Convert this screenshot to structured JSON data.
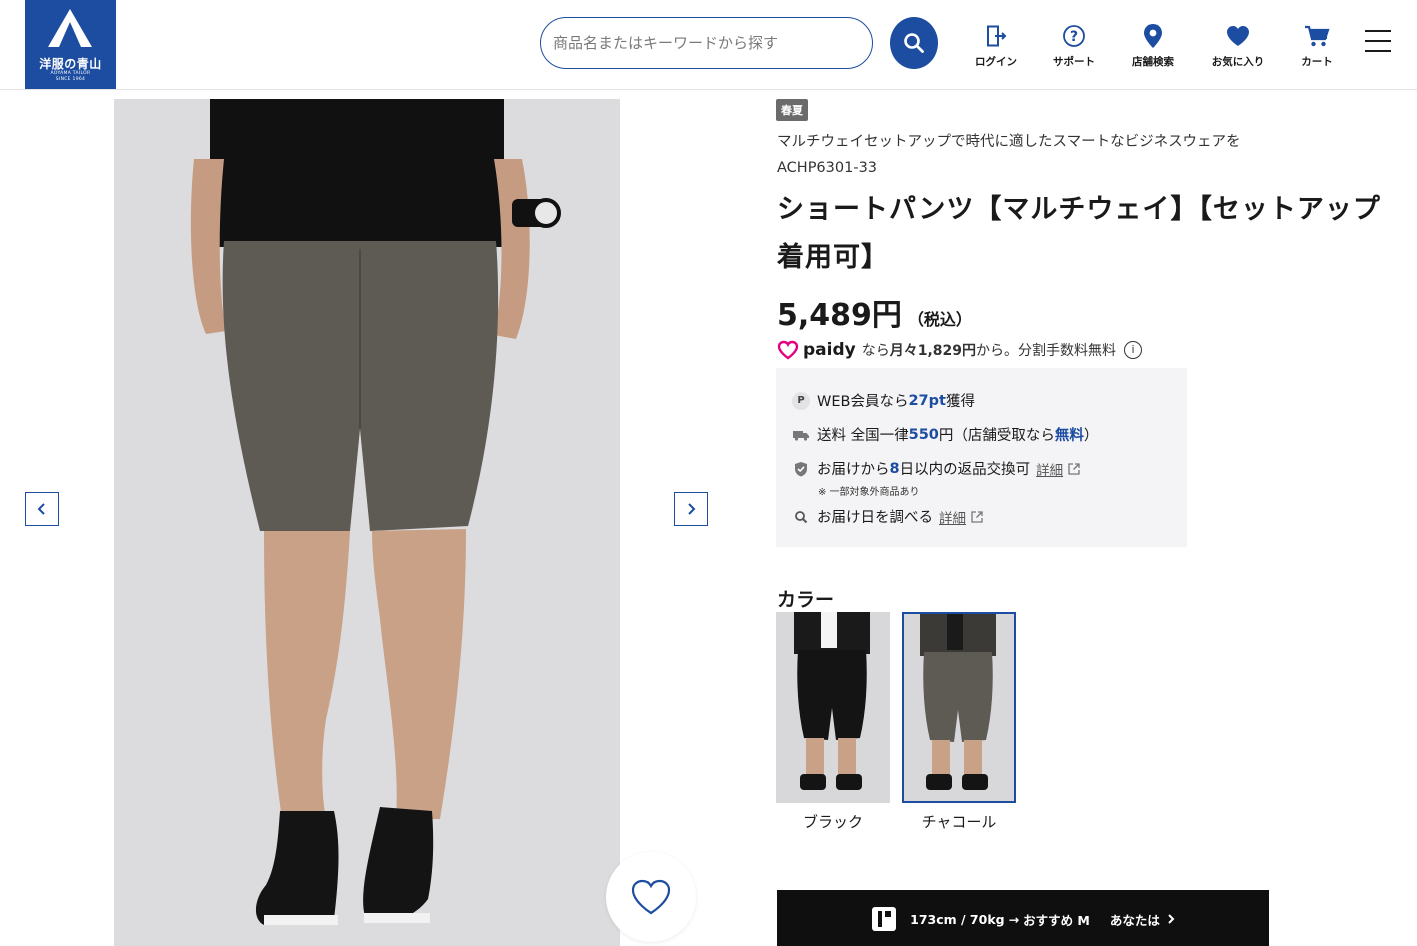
{
  "header": {
    "logo": {
      "text": "洋服の青山",
      "sub1": "AOYAMA TAILOR",
      "sub2": "SINCE 1964"
    },
    "search": {
      "placeholder": "商品名またはキーワードから探す"
    },
    "nav": [
      {
        "label": "ログイン",
        "icon": "login-door-icon"
      },
      {
        "label": "サポート",
        "icon": "question-circle-icon"
      },
      {
        "label": "店舗検索",
        "icon": "map-pin-icon"
      },
      {
        "label": "お気に入り",
        "icon": "heart-icon"
      },
      {
        "label": "カート",
        "icon": "cart-icon"
      }
    ]
  },
  "product": {
    "season": "春夏",
    "catch": "マルチウェイセットアップで時代に適したスマートなビジネスウェアを",
    "sku": "ACHP6301-33",
    "title": "ショートパンツ【マルチウェイ】【セットアップ着用可】",
    "price": "5,489円",
    "price_tax": "（税込）",
    "paidy": {
      "logo": "paidy",
      "pre": "なら",
      "monthly": "月々1,829円",
      "post": "から。分割手数料無料",
      "info": "i"
    }
  },
  "benefits": {
    "points": {
      "icon": "P",
      "pre": "WEB会員なら",
      "value": "27pt",
      "post": "獲得"
    },
    "shipping": {
      "pre": "送料 全国一律",
      "value": "550",
      "mid": "円（店舗受取なら",
      "free": "無料",
      "post": "）"
    },
    "returns": {
      "pre": "お届けから ",
      "value": "8",
      "post": " 日以内の返品交換可",
      "link": "詳細",
      "note": "※ 一部対象外商品あり"
    },
    "delivery": {
      "text": "お届け日を調べる",
      "link": "詳細"
    }
  },
  "colors": {
    "heading": "カラー",
    "options": [
      {
        "label": "ブラック",
        "selected": false
      },
      {
        "label": "チャコール",
        "selected": true
      }
    ]
  },
  "recommend": {
    "size": "173cm / 70kg",
    "arrow": "→",
    "label": "おすすめ M",
    "you": "あなたは"
  },
  "colors_theme": {
    "brand": "#1c4da1",
    "badge": "#6b6b6b",
    "bar": "#0f0f0f"
  }
}
